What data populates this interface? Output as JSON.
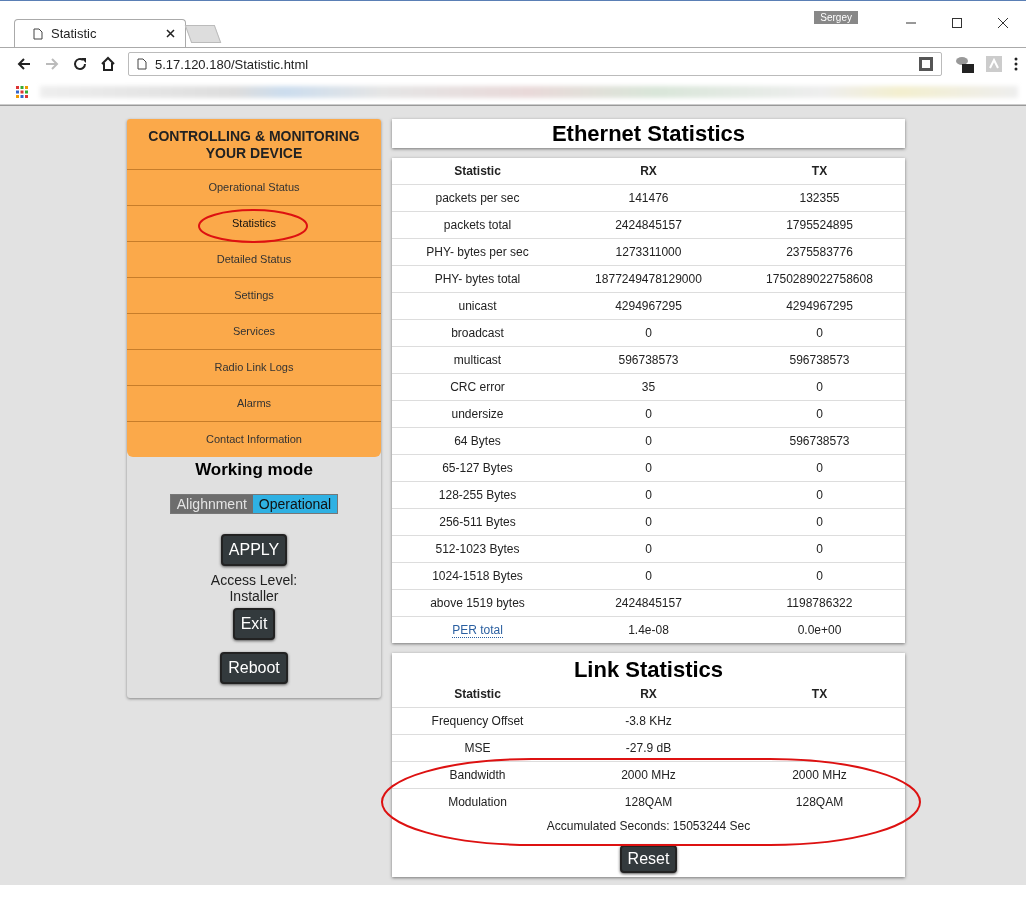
{
  "window": {
    "user": "Sergey"
  },
  "tabs": [
    {
      "label": "Statistic",
      "selected": true
    }
  ],
  "address_bar": {
    "url": "5.17.120.180/Statistic.html"
  },
  "sidebar": {
    "title": "CONTROLLING & MONITORING YOUR DEVICE",
    "items": [
      {
        "label": "Operational Status",
        "selected": false
      },
      {
        "label": "Statistics",
        "selected": true
      },
      {
        "label": "Detailed Status",
        "selected": false
      },
      {
        "label": "Settings",
        "selected": false
      },
      {
        "label": "Services",
        "selected": false
      },
      {
        "label": "Radio Link Logs",
        "selected": false
      },
      {
        "label": "Alarms",
        "selected": false
      },
      {
        "label": "Contact Information",
        "selected": false
      }
    ],
    "working_mode": {
      "title": "Working mode",
      "options": [
        {
          "label": "Alighnment",
          "selected": false
        },
        {
          "label": "Operational",
          "selected": true
        }
      ]
    },
    "apply_button": "APPLY",
    "access_level": "Access Level:",
    "access_role": "Installer",
    "exit_button": "Exit",
    "reboot_button": "Reboot"
  },
  "ethernet": {
    "title": "Ethernet Statistics",
    "columns": [
      "Statistic",
      "RX",
      "TX"
    ],
    "rows": [
      {
        "kind": "text",
        "cells": [
          "packets per sec",
          "141476",
          "132355"
        ]
      },
      {
        "kind": "text",
        "cells": [
          "packets total",
          "2424845157",
          "1795524895"
        ]
      },
      {
        "kind": "text",
        "cells": [
          "PHY- bytes per sec",
          "1273311000",
          "2375583776"
        ]
      },
      {
        "kind": "text",
        "cells": [
          "PHY- bytes total",
          "1877249478129000",
          "1750289022758608"
        ]
      },
      {
        "kind": "text",
        "cells": [
          "unicast",
          "4294967295",
          "4294967295"
        ]
      },
      {
        "kind": "text",
        "cells": [
          "broadcast",
          "0",
          "0"
        ]
      },
      {
        "kind": "text",
        "cells": [
          "multicast",
          "596738573",
          "596738573"
        ]
      },
      {
        "kind": "text",
        "cells": [
          "CRC error",
          "35",
          "0"
        ]
      },
      {
        "kind": "text",
        "cells": [
          "undersize",
          "0",
          "0"
        ]
      },
      {
        "kind": "text",
        "cells": [
          "64 Bytes",
          "0",
          "596738573"
        ]
      },
      {
        "kind": "text",
        "cells": [
          "65-127 Bytes",
          "0",
          "0"
        ]
      },
      {
        "kind": "text",
        "cells": [
          "128-255 Bytes",
          "0",
          "0"
        ]
      },
      {
        "kind": "text",
        "cells": [
          "256-511 Bytes",
          "0",
          "0"
        ]
      },
      {
        "kind": "text",
        "cells": [
          "512-1023 Bytes",
          "0",
          "0"
        ]
      },
      {
        "kind": "text",
        "cells": [
          "1024-1518 Bytes",
          "0",
          "0"
        ]
      },
      {
        "kind": "text",
        "cells": [
          "above 1519 bytes",
          "2424845157",
          "1198786322"
        ]
      },
      {
        "kind": "link",
        "cells": [
          "PER total",
          "1.4e-08",
          "0.0e+00"
        ]
      }
    ]
  },
  "link": {
    "title": "Link Statistics",
    "columns": [
      "Statistic",
      "RX",
      "TX"
    ],
    "rows": [
      {
        "cells": [
          "Frequency Offset",
          "-3.8 KHz",
          ""
        ]
      },
      {
        "cells": [
          "MSE",
          "-27.9 dB",
          ""
        ]
      },
      {
        "cells": [
          "Bandwidth",
          "2000 MHz",
          "2000 MHz"
        ]
      },
      {
        "cells": [
          "Modulation",
          "128QAM",
          "128QAM"
        ]
      }
    ],
    "accumulated": "Accumulated Seconds: 15053244 Sec",
    "reset_button": "Reset"
  }
}
